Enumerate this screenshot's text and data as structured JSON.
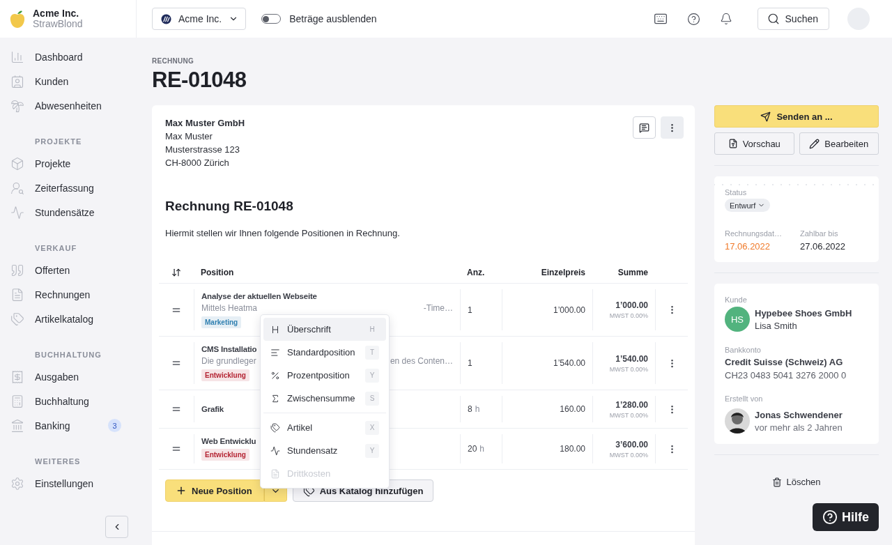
{
  "brand": {
    "name": "Acme Inc.",
    "subtitle": "StrawBlond"
  },
  "topbar": {
    "company": "Acme Inc.",
    "toggle": {
      "label": "Beträge ausblenden",
      "on": false
    },
    "search": "Suchen"
  },
  "sidebar": {
    "sections": [
      {
        "items": [
          {
            "label": "Dashboard"
          },
          {
            "label": "Kunden"
          },
          {
            "label": "Abwesenheiten"
          }
        ]
      },
      {
        "title": "PROJEKTE",
        "items": [
          {
            "label": "Projekte"
          },
          {
            "label": "Zeiterfassung"
          },
          {
            "label": "Stundensätze"
          }
        ]
      },
      {
        "title": "VERKAUF",
        "items": [
          {
            "label": "Offerten"
          },
          {
            "label": "Rechnungen"
          },
          {
            "label": "Artikelkatalog"
          }
        ]
      },
      {
        "title": "BUCHHALTUNG",
        "items": [
          {
            "label": "Ausgaben"
          },
          {
            "label": "Buchhaltung"
          },
          {
            "label": "Banking",
            "badge": "3"
          }
        ]
      },
      {
        "title": "WEITERES",
        "items": [
          {
            "label": "Einstellungen"
          }
        ]
      }
    ]
  },
  "page": {
    "eyebrow": "RECHNUNG",
    "title": "RE-01048"
  },
  "invoice": {
    "address": [
      "Max Muster GmbH",
      "Max Muster",
      "Musterstrasse 123",
      "CH-8000 Zürich"
    ],
    "heading": "Rechnung RE-01048",
    "intro": "Hiermit stellen wir Ihnen folgende Positionen in Rechnung.",
    "columns": [
      "Position",
      "Anz.",
      "Einzelpreis",
      "Summe"
    ],
    "rows": [
      {
        "title": "Analyse der aktuellen Webseite",
        "description_start": "Mittels Heatma",
        "description_end": "-Time…",
        "tag": {
          "label": "Marketing",
          "color": "#2f7fb0"
        },
        "qty": "1",
        "price": "1’000.00",
        "sum": "1’000.00",
        "vat": "MWST 0.00%"
      },
      {
        "title": "CMS Installatio",
        "description_start": "Die grundleger",
        "description_end": "en des Conten…",
        "tag": {
          "label": "Entwicklung",
          "color": "#b42332"
        },
        "qty": "1",
        "price": "1’540.00",
        "sum": "1’540.00",
        "vat": "MWST 0.00%"
      },
      {
        "title": "Grafik",
        "qty": "8",
        "unit": "h",
        "price": "160.00",
        "sum": "1’280.00",
        "vat": "MWST 0.00%"
      },
      {
        "title": "Web Entwicklu",
        "tag": {
          "label": "Entwicklung",
          "color": "#b42332"
        },
        "qty": "20",
        "unit": "h",
        "price": "180.00",
        "sum": "3’600.00",
        "vat": "MWST 0.00%"
      }
    ],
    "menu": [
      [
        {
          "label": "Überschrift",
          "shortcut": "H",
          "selected": true,
          "disabled": false
        },
        {
          "label": "Standardposition",
          "shortcut": "T",
          "selected": false,
          "disabled": false
        },
        {
          "label": "Prozentposition",
          "shortcut": "Y",
          "selected": false,
          "disabled": false
        },
        {
          "label": "Zwischensumme",
          "shortcut": "S",
          "selected": false,
          "disabled": false
        }
      ],
      [
        {
          "label": "Artikel",
          "shortcut": "X",
          "selected": false,
          "disabled": false
        },
        {
          "label": "Stundensatz",
          "shortcut": "Y",
          "selected": false,
          "disabled": false
        },
        {
          "label": "Drittkosten",
          "selected": false,
          "disabled": true
        }
      ]
    ],
    "add_button": "Neue Position",
    "catalog_button": "Aus Katalog hinzufügen"
  },
  "actions": {
    "send": "Senden an ...",
    "preview": "Vorschau",
    "edit": "Bearbeiten"
  },
  "status": {
    "label": "Status",
    "value": "Entwurf",
    "date_label": "Rechnungsdat…",
    "date": "17.06.2022",
    "due_label": "Zahlbar bis",
    "due": "27.06.2022"
  },
  "customer": {
    "label": "Kunde",
    "initials": "HS",
    "name": "Hypebee Shoes GmbH",
    "contact": "Lisa Smith",
    "bank_label": "Bankkonto",
    "bank": "Credit Suisse (Schweiz) AG",
    "iban": "CH23 0483 5041 3276 2000 0",
    "creator_label": "Erstellt von",
    "creator": "Jonas Schwendener",
    "created": "vor mehr als 2 Jahren"
  },
  "delete": "Löschen",
  "help": "Hilfe"
}
